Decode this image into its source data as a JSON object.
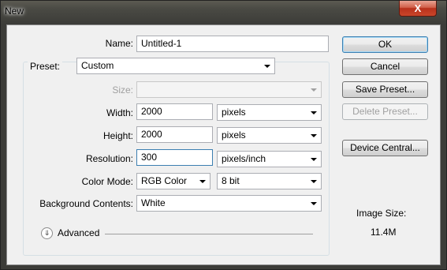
{
  "window": {
    "title": "New",
    "close_symbol": "X"
  },
  "name": {
    "label": "Name:",
    "value": "Untitled-1"
  },
  "preset": {
    "label": "Preset:",
    "value": "Custom"
  },
  "size": {
    "label": "Size:",
    "value": ""
  },
  "width": {
    "label": "Width:",
    "value": "2000",
    "unit": "pixels"
  },
  "height": {
    "label": "Height:",
    "value": "2000",
    "unit": "pixels"
  },
  "resolution": {
    "label": "Resolution:",
    "value": "300",
    "unit": "pixels/inch"
  },
  "color_mode": {
    "label": "Color Mode:",
    "value": "RGB Color",
    "depth": "8 bit"
  },
  "background": {
    "label": "Background Contents:",
    "value": "White"
  },
  "advanced": {
    "label": "Advanced",
    "icon": "chevron-double-down-icon"
  },
  "buttons": {
    "ok": "OK",
    "cancel": "Cancel",
    "save_preset": "Save Preset...",
    "delete_preset": "Delete Preset...",
    "device_central": "Device Central..."
  },
  "image_size": {
    "label": "Image Size:",
    "value": "11.4M"
  }
}
